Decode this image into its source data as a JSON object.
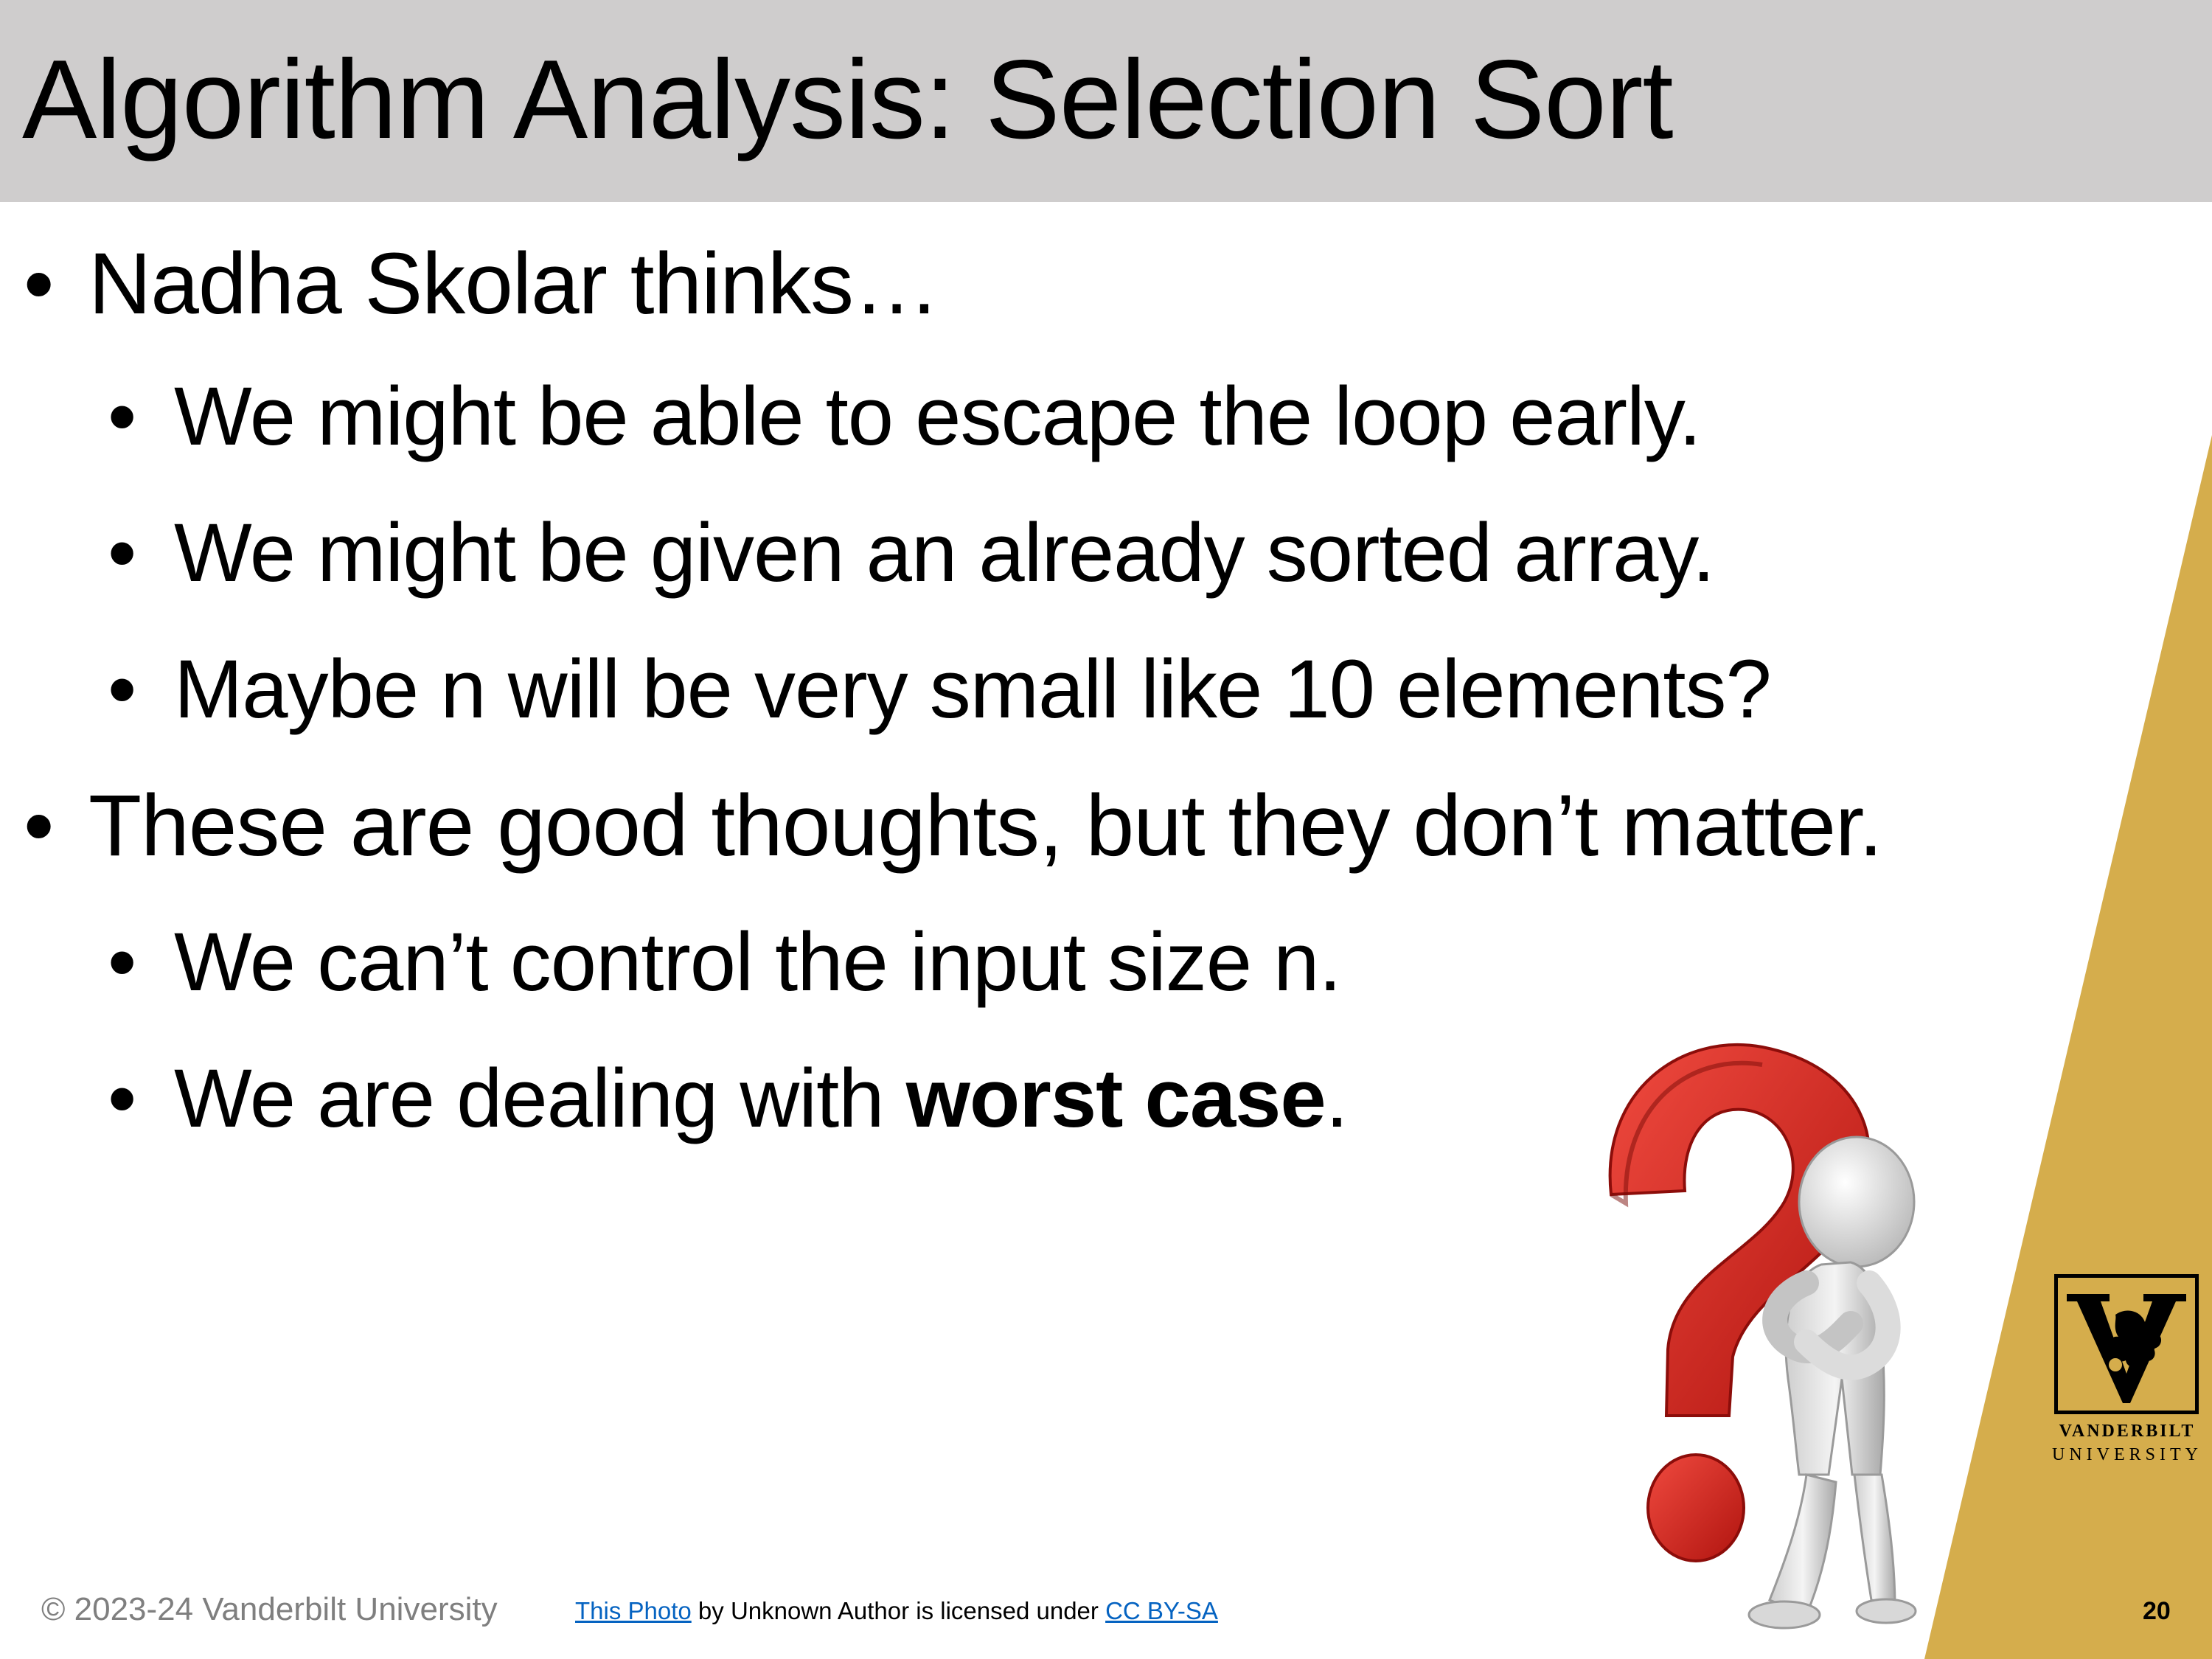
{
  "slide": {
    "title": "Algorithm Analysis: Selection Sort",
    "bullets": [
      {
        "level": 1,
        "text": "Nadha Skolar thinks…"
      },
      {
        "level": 2,
        "text": "We might be able to escape the loop early."
      },
      {
        "level": 2,
        "text": "We might be given an already sorted array."
      },
      {
        "level": 2,
        "text": "Maybe n will be very small like 10 elements?"
      },
      {
        "level": 1,
        "text": "These are good thoughts, but they don’t matter."
      },
      {
        "level": 2,
        "text": "We can’t control the input size n."
      },
      {
        "level": 2,
        "text_before": "We are dealing with ",
        "text_bold": "worst case",
        "text_after": "."
      }
    ],
    "bullet_char": "•",
    "page_number": "20"
  },
  "footer": {
    "copyright": "© 2023-24 Vanderbilt University",
    "attribution": {
      "link1": "This Photo",
      "middle": " by Unknown Author is licensed under ",
      "link2": "CC BY-SA"
    }
  },
  "logo": {
    "line1": "VANDERBILT",
    "line2": "UNIVERSITY"
  },
  "colors": {
    "title_band": "#cfcdcd",
    "gold": "#d5ad4c",
    "question_mark_red": "#e3231e",
    "link_blue": "#0563c1",
    "footer_gray": "#7f7f7f"
  }
}
